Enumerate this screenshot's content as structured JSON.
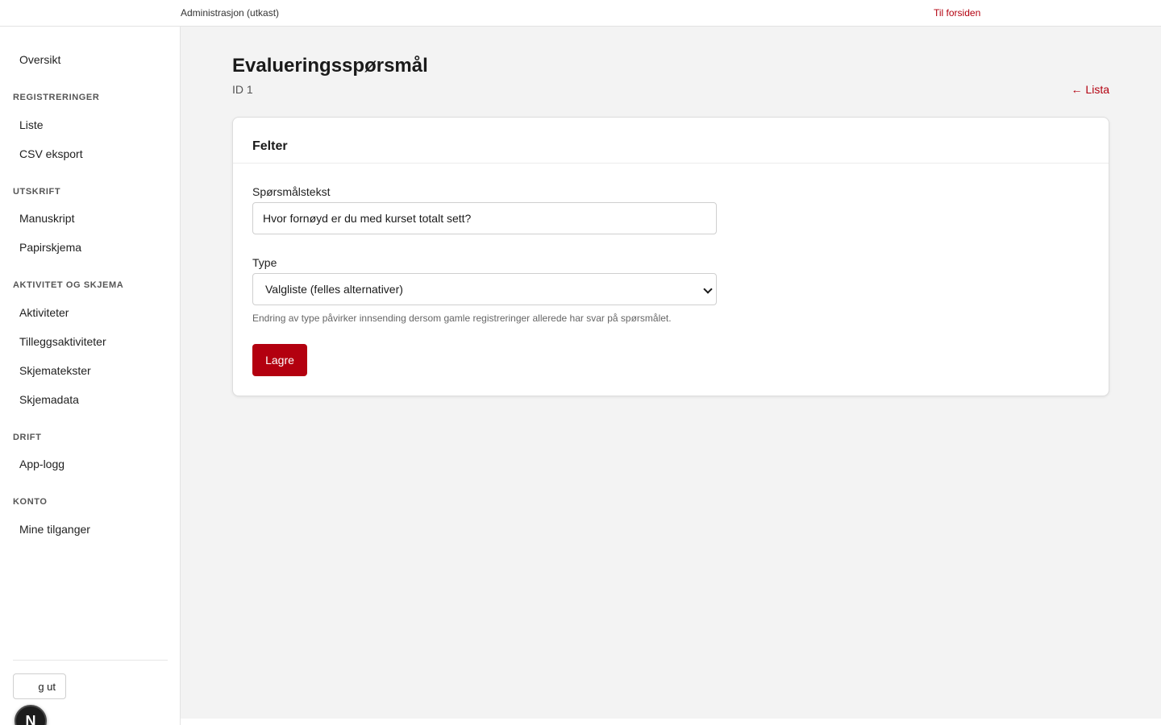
{
  "topbar": {
    "brand": "Administrasjon (utkast)",
    "home_link": "Til forsiden"
  },
  "sidebar": {
    "overview": "Oversikt",
    "sections": [
      {
        "heading": "REGISTRERINGER",
        "items": [
          "Liste",
          "CSV eksport"
        ]
      },
      {
        "heading": "UTSKRIFT",
        "items": [
          "Manuskript",
          "Papirskjema"
        ]
      },
      {
        "heading": "AKTIVITET OG SKJEMA",
        "items": [
          "Aktiviteter",
          "Tilleggsaktiviteter",
          "Skjematekster",
          "Skjemadata"
        ]
      },
      {
        "heading": "DRIFT",
        "items": [
          "App-logg"
        ]
      },
      {
        "heading": "KONTO",
        "items": [
          "Mine tilganger"
        ]
      }
    ],
    "logout_label": "g ut",
    "next_badge": "N"
  },
  "page": {
    "title": "Evalueringsspørsmål",
    "id_text": "ID 1",
    "back_link": "← Lista"
  },
  "card": {
    "title": "Felter",
    "question_label": "Spørsmålstekst",
    "question_value": "Hvor fornøyd er du med kurset totalt sett?",
    "type_label": "Type",
    "type_selected": "Valgliste (felles alternativer)",
    "help_text": "Endring av type påvirker innsending dersom gamle registreringer allerede har svar på spørsmålet.",
    "save_label": "Lagre"
  },
  "colors": {
    "accent": "#b3000f",
    "background": "#f3f3f3"
  }
}
